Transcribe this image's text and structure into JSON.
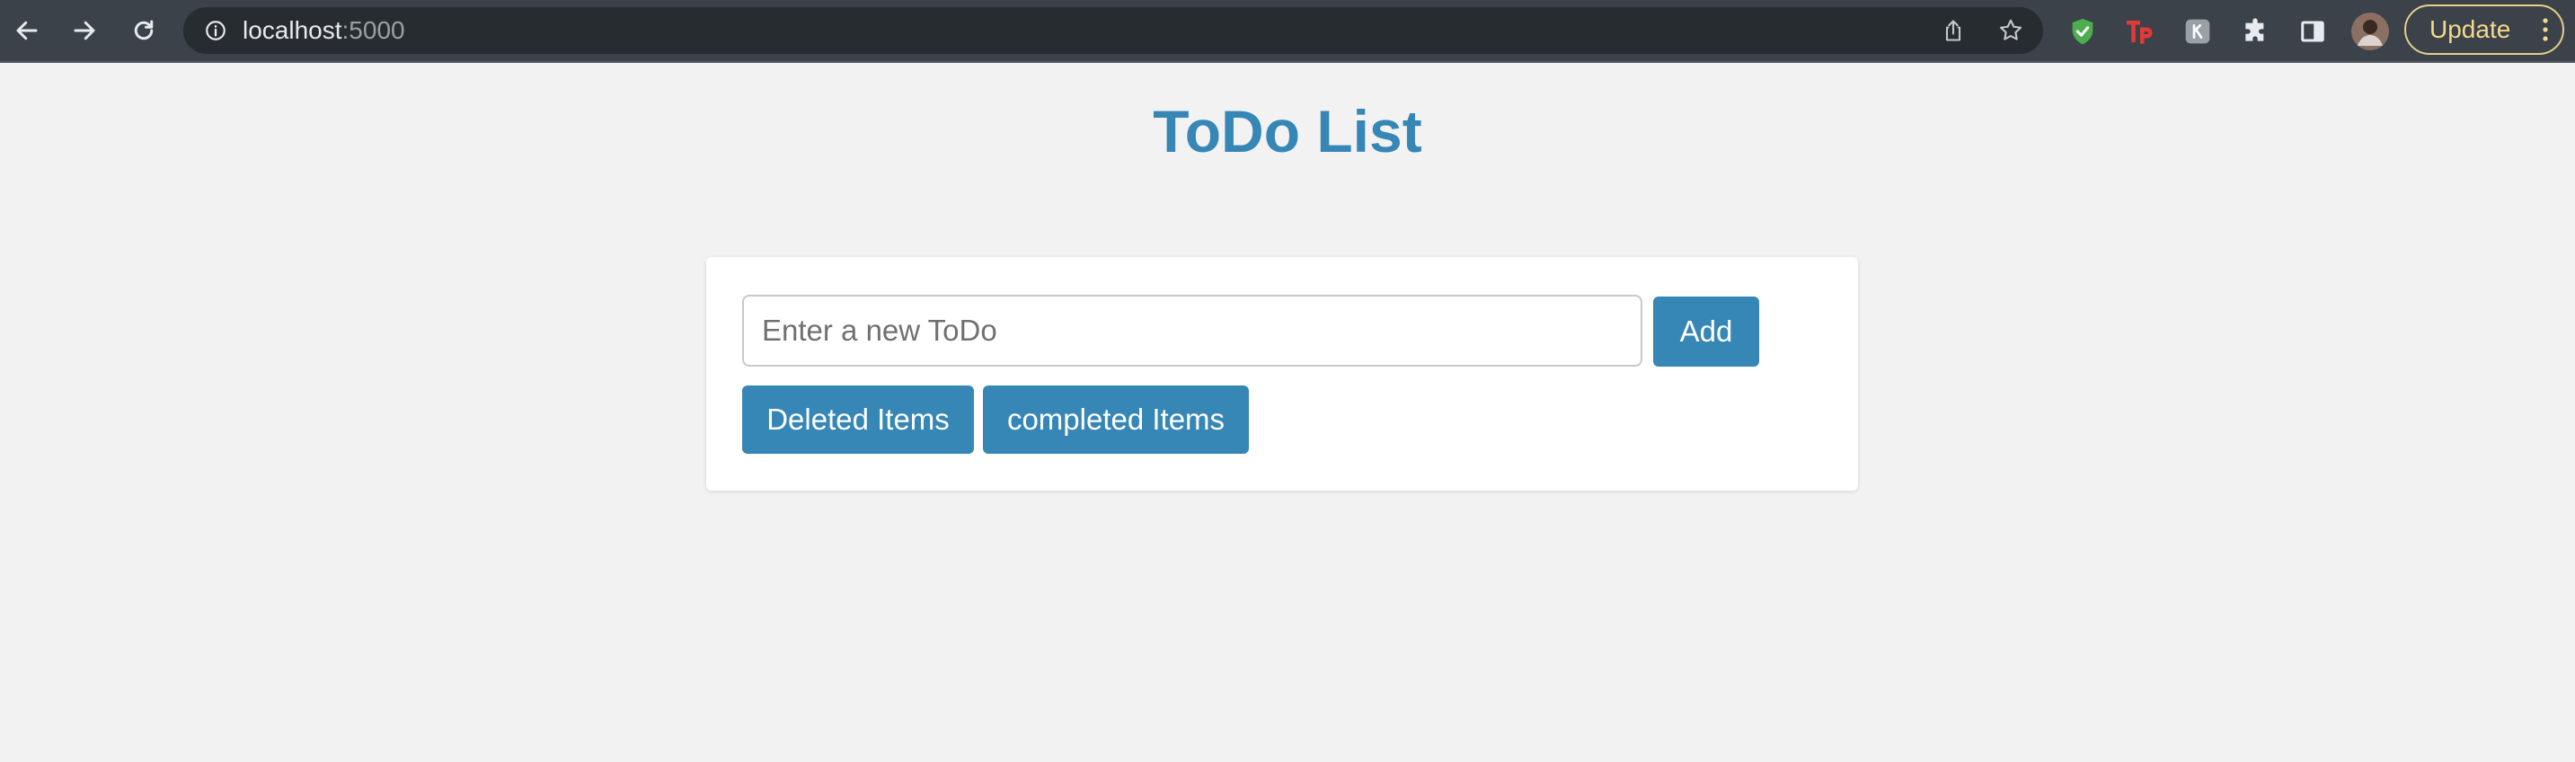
{
  "browser": {
    "url_host": "localhost",
    "url_port": ":5000",
    "update_label": "Update",
    "icons": {
      "back": "arrow-left-icon",
      "forward": "arrow-right-icon",
      "reload": "reload-icon",
      "site_info": "info-icon",
      "share": "share-icon",
      "bookmark": "star-icon",
      "ext1": "shield-check-icon",
      "ext2": "tp-icon",
      "ext3": "grey-square-icon",
      "extensions": "puzzle-icon",
      "side_panel": "side-panel-icon",
      "profile": "avatar",
      "menu": "three-dots-icon"
    }
  },
  "page": {
    "title": "ToDo List",
    "input_placeholder": "Enter a new ToDo",
    "input_value": "",
    "add_label": "Add",
    "deleted_label": "Deleted Items",
    "completed_label": "completed Items"
  },
  "colors": {
    "accent": "#3686b6",
    "background": "#f2f2f2",
    "chrome": "#3b4249",
    "update_border": "#e6cf8f"
  }
}
